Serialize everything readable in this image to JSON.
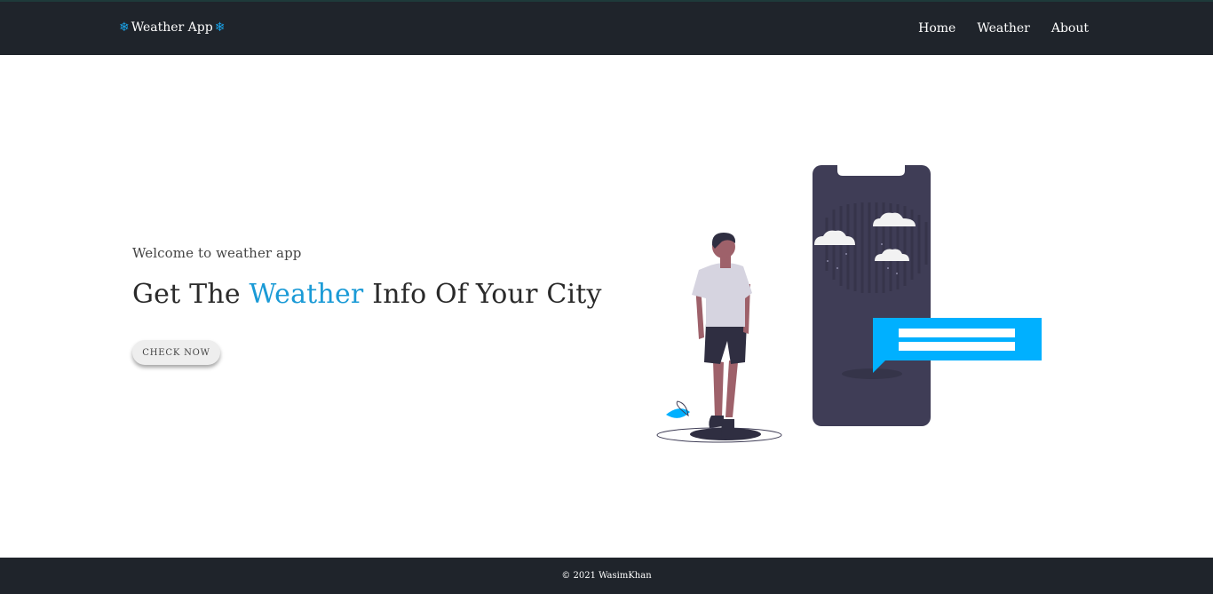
{
  "nav": {
    "brand": "Weather App",
    "links": [
      "Home",
      "Weather",
      "About"
    ]
  },
  "hero": {
    "welcome": "Welcome to weather app",
    "headline_pre": "Get The ",
    "headline_accent": "Weather",
    "headline_post": " Info Of Your City",
    "button": "CHECK NOW"
  },
  "footer": {
    "copyright": "© 2021 WasimKhan"
  },
  "colors": {
    "nav_bg": "#1f242b",
    "accent": "#1a9ad6",
    "phone": "#3f3d56",
    "bubble": "#00b0ff"
  }
}
